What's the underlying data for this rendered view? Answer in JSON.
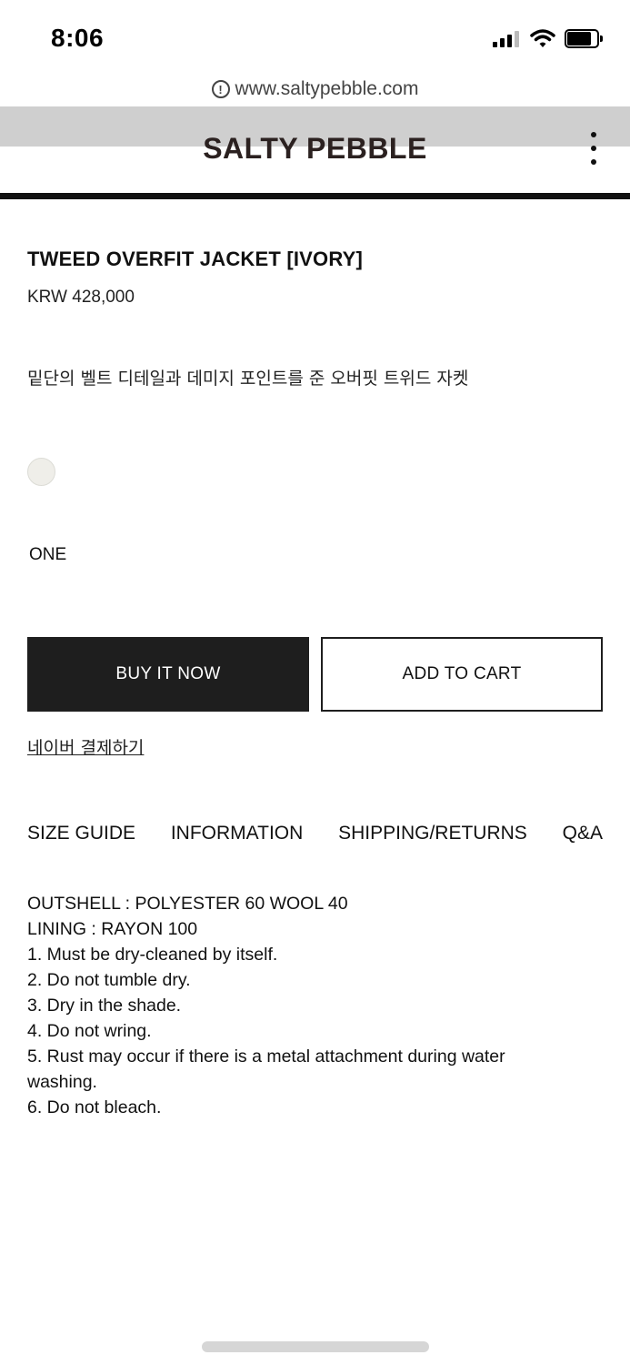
{
  "status_bar": {
    "time": "8:06",
    "icons": [
      "signal-icon",
      "wifi-icon",
      "battery-icon"
    ]
  },
  "browser": {
    "url": "www.saltypebble.com",
    "info_icon": "info-icon"
  },
  "header": {
    "brand": "SALTY PEBBLE",
    "menu_icon": "kebab-menu-icon"
  },
  "product": {
    "title": "TWEED OVERFIT JACKET [IVORY]",
    "price": "KRW 428,000",
    "description": "밑단의 벨트 디테일과 데미지 포인트를 준 오버핏 트위드 자켓",
    "color_swatch": "#efeee9",
    "size_option": "ONE"
  },
  "actions": {
    "buy_now": "BUY IT NOW",
    "add_to_cart": "ADD TO CART",
    "naver_pay": "네이버 결제하기"
  },
  "tabs": [
    "SIZE GUIDE",
    "INFORMATION",
    "SHIPPING/RETURNS",
    "Q&A"
  ],
  "information": [
    "OUTSHELL : POLYESTER 60 WOOL 40",
    "LINING : RAYON 100",
    "1. Must be dry-cleaned by itself.",
    "2. Do not tumble dry.",
    "3. Dry in the shade.",
    "4. Do not wring.",
    "5. Rust may occur if there is a metal attachment during water washing.",
    "6. Do not bleach."
  ],
  "colors": {
    "accent_dark": "#1e1e1e",
    "brand_text": "#2b2120",
    "header_band": "#cfcfcf"
  }
}
